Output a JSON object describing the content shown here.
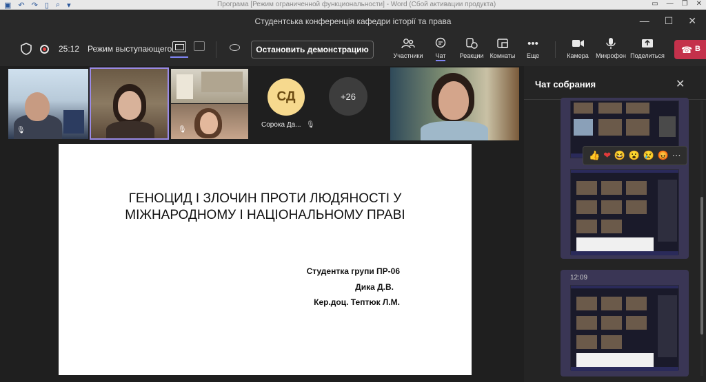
{
  "word_bar": {
    "title": "Програма [Режим ограниченной функциональности] - Word (Сбой активации продукта)",
    "icons": [
      "save-icon",
      "undo-icon",
      "redo-icon",
      "new-document-icon",
      "print-preview-icon",
      "customize-arrow-icon"
    ]
  },
  "window": {
    "title": "Студентська конференція кафедри історії та права"
  },
  "toolbar": {
    "timer": "25:12",
    "mode_label": "Режим выступающего",
    "stop_label": "Остановить демонстрацию",
    "tools": [
      {
        "label": "Участники",
        "icon": "participants-icon"
      },
      {
        "label": "Чат",
        "icon": "chat-icon"
      },
      {
        "label": "Реакции",
        "icon": "reactions-icon"
      },
      {
        "label": "Комнаты",
        "icon": "rooms-icon"
      },
      {
        "label": "Еще",
        "icon": "more-icon"
      },
      {
        "label": "Камера",
        "icon": "camera-icon"
      },
      {
        "label": "Микрофон",
        "icon": "microphone-icon"
      },
      {
        "label": "Поделиться",
        "icon": "share-icon"
      }
    ],
    "leave_label": "В"
  },
  "participants": {
    "avatar_initials": "СД",
    "avatar_name": "Сорока Да...",
    "overflow_count": "+26"
  },
  "slide": {
    "title_line1": "ГЕНОЦИД І ЗЛОЧИН ПРОТИ ЛЮДЯНОСТІ У",
    "title_line2": "МІЖНАРОДНОМУ І НАЦІОНАЛЬНОМУ ПРАВІ",
    "line1": "Студентка групи ПР-06",
    "line2": "Дика Д.В.",
    "line3": "Кер.доц. Тептюк Л.М."
  },
  "chat": {
    "title": "Чат собрания",
    "time": "12:09",
    "reactions": [
      "like",
      "heart",
      "laugh",
      "surprised",
      "sad",
      "angry",
      "more"
    ]
  }
}
